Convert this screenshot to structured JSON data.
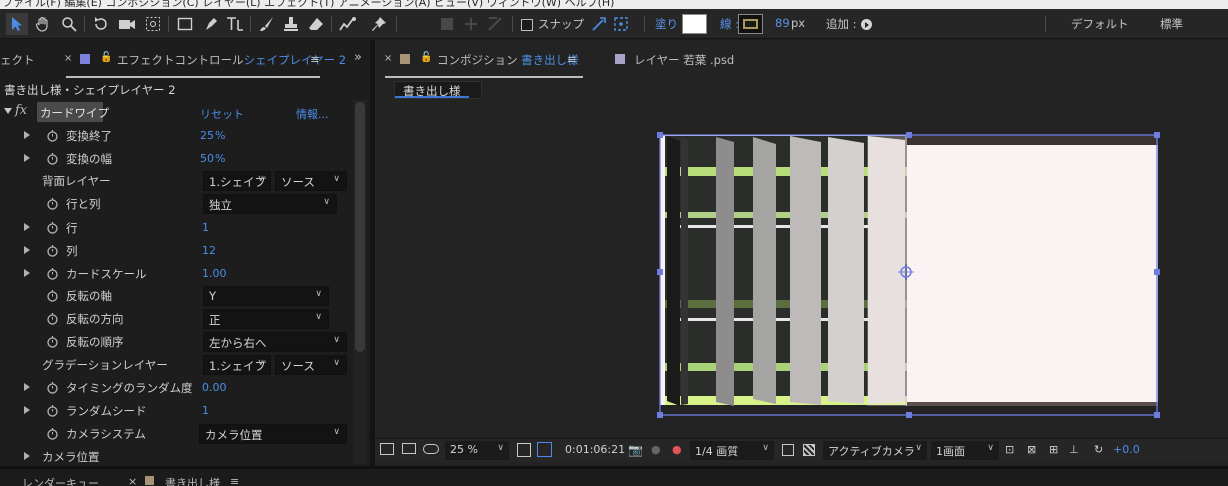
{
  "menubar": {
    "text": "ファイル(F)  編集(E)  コンポジション(C)  レイヤー(L)  エフェクト(T)  アニメーション(A)  ビュー(V)  ウィンドウ(W)  ヘルプ(H)"
  },
  "toolbar": {
    "snap_label": "スナップ",
    "fill_label": "塗り :",
    "stroke_label": "線 :",
    "stroke_width": "89",
    "stroke_unit": "px",
    "add_label": "追加 :",
    "workspace_default": "デフォルト",
    "workspace_standard": "標準",
    "fill_color": "#ffffff",
    "stroke_color": "#2b2b2b"
  },
  "left_panel": {
    "prev_tab": "ェクト",
    "tab_title": "エフェクトコントロール",
    "tab_layer": "シェイプレイヤー 2",
    "layer_title": "書き出し様・シェイプレイヤー 2",
    "effect": {
      "name": "カードワイプ",
      "fx": "fx",
      "reset": "リセット",
      "info": "情報..."
    },
    "properties": [
      {
        "label": "変換終了",
        "value": "25",
        "unit": "%"
      },
      {
        "label": "変換の幅",
        "value": "50",
        "unit": "%"
      },
      {
        "label": "背面レイヤー",
        "dd1": "1.シェイプ",
        "dd2": "ソース"
      },
      {
        "label": "行と列",
        "dd": "独立"
      },
      {
        "label": "行",
        "value": "1"
      },
      {
        "label": "列",
        "value": "12"
      },
      {
        "label": "カードスケール",
        "value": "1.00"
      },
      {
        "label": "反転の軸",
        "dd": "Y"
      },
      {
        "label": "反転の方向",
        "dd": "正"
      },
      {
        "label": "反転の順序",
        "dd": "左から右へ"
      },
      {
        "label": "グラデーションレイヤー",
        "dd1": "1.シェイプ",
        "dd2": "ソース"
      },
      {
        "label": "タイミングのランダム度",
        "value": "0.00"
      },
      {
        "label": "ランダムシード",
        "value": "1"
      },
      {
        "label": "カメラシステム",
        "dd": "カメラ位置"
      },
      {
        "label": "カメラ位置"
      }
    ]
  },
  "comp_panel": {
    "tab_prefix": "コンポジション",
    "tab_name": "書き出し様",
    "layer_tab": "レイヤー 若葉 .psd",
    "crumb": "書き出し様",
    "footer": {
      "zoom": "25 %",
      "timecode": "0:01:06:21",
      "resolution": "1/4 画質",
      "camera": "アクティブカメラ",
      "views": "1画面",
      "exposure": "+0.0"
    }
  },
  "bottom": {
    "render_queue": "レンダーキュー",
    "comp_name": "書き出し様"
  },
  "colors": {
    "accent": "#4b8de6",
    "selection": "#6e7de0",
    "effect_swatch": "#7c83d8",
    "comp_swatch": "#a79378",
    "layer_swatch": "#a8a4c6"
  }
}
